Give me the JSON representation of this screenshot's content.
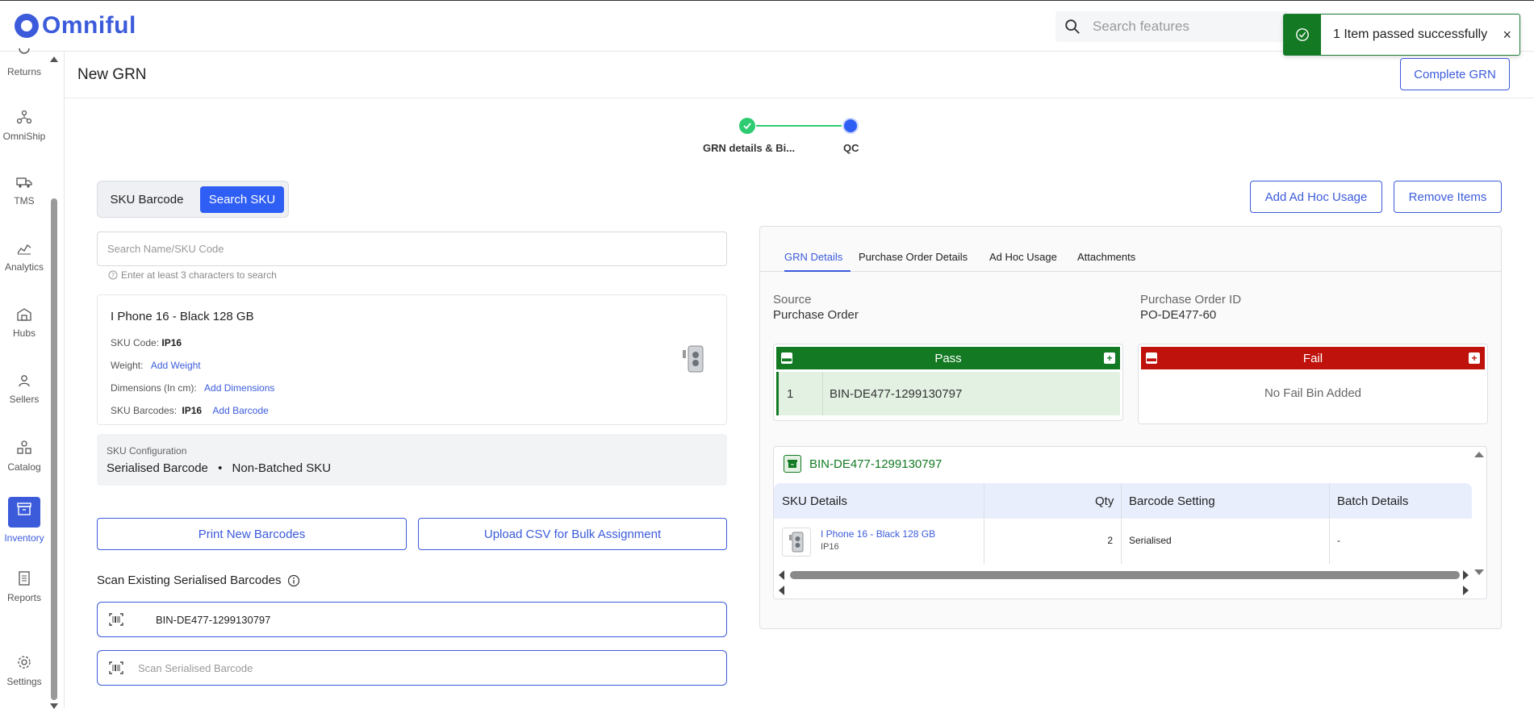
{
  "app": {
    "brand": "Omniful",
    "brand_color": "#3b5bdb"
  },
  "topbar": {
    "search_placeholder": "Search features",
    "toast": {
      "message": "1 Item passed successfully",
      "close_label": "×"
    }
  },
  "sidebar": {
    "items": [
      {
        "label": "Returns",
        "icon": "returns-icon"
      },
      {
        "label": "OmniShip",
        "icon": "omniship-icon"
      },
      {
        "label": "TMS",
        "icon": "truck-icon"
      },
      {
        "label": "Analytics",
        "icon": "chart-icon"
      },
      {
        "label": "Hubs",
        "icon": "warehouse-icon"
      },
      {
        "label": "Sellers",
        "icon": "user-icon"
      },
      {
        "label": "Catalog",
        "icon": "catalog-icon"
      },
      {
        "label": "Inventory",
        "icon": "inventory-icon",
        "active": true
      },
      {
        "label": "Reports",
        "icon": "report-icon"
      },
      {
        "label": "Settings",
        "icon": "gear-icon"
      }
    ]
  },
  "header": {
    "title": "New GRN",
    "complete_label": "Complete GRN"
  },
  "stepper": {
    "steps": [
      {
        "label": "GRN details & Bi...",
        "state": "done"
      },
      {
        "label": "QC",
        "state": "current"
      }
    ]
  },
  "mode_toggle": {
    "options": [
      "SKU Barcode",
      "Search SKU"
    ],
    "selected": "Search SKU"
  },
  "sku_search": {
    "placeholder": "Search Name/SKU Code",
    "hint": "Enter at least 3 characters to search"
  },
  "sku_card": {
    "name": "I Phone 16 - Black 128 GB",
    "sku_code_label": "SKU Code:",
    "sku_code": "IP16",
    "weight_label": "Weight:",
    "weight_link": "Add Weight",
    "dimensions_label": "Dimensions (In cm):",
    "dimensions_link": "Add Dimensions",
    "barcodes_label": "SKU Barcodes:",
    "barcodes_value": "IP16",
    "barcodes_link": "Add Barcode"
  },
  "sku_config": {
    "label": "SKU Configuration",
    "barcode_type": "Serialised Barcode",
    "separator": "•",
    "batch_type": "Non-Batched SKU"
  },
  "actions": {
    "print_label": "Print New Barcodes",
    "upload_label": "Upload CSV for Bulk Assignment",
    "ad_hoc_label": "Add Ad Hoc Usage",
    "remove_label": "Remove Items"
  },
  "scan": {
    "title": "Scan Existing Serialised Barcodes",
    "scanned_value": "BIN-DE477-1299130797",
    "placeholder": "Scan Serialised Barcode"
  },
  "details_tabs": {
    "tabs": [
      "GRN Details",
      "Purchase Order Details",
      "Ad Hoc Usage",
      "Attachments"
    ],
    "active": "GRN Details"
  },
  "grn_details": {
    "source_label": "Source",
    "source_value": "Purchase Order",
    "po_label": "Purchase Order ID",
    "po_value": "PO-DE477-60"
  },
  "bins": {
    "pass": {
      "title": "Pass",
      "color": "#137a23",
      "rows": [
        {
          "index": "1",
          "bin": "BIN-DE477-1299130797"
        }
      ]
    },
    "fail": {
      "title": "Fail",
      "color": "#c0120c",
      "empty_text": "No Fail Bin Added"
    }
  },
  "bin_detail": {
    "bin_name": "BIN-DE477-1299130797",
    "columns": [
      "SKU Details",
      "Qty",
      "Barcode Setting",
      "Batch Details"
    ],
    "rows": [
      {
        "name": "I Phone 16 - Black 128 GB",
        "code": "IP16",
        "qty": "2",
        "barcode_setting": "Serialised",
        "batch": "-"
      }
    ]
  }
}
